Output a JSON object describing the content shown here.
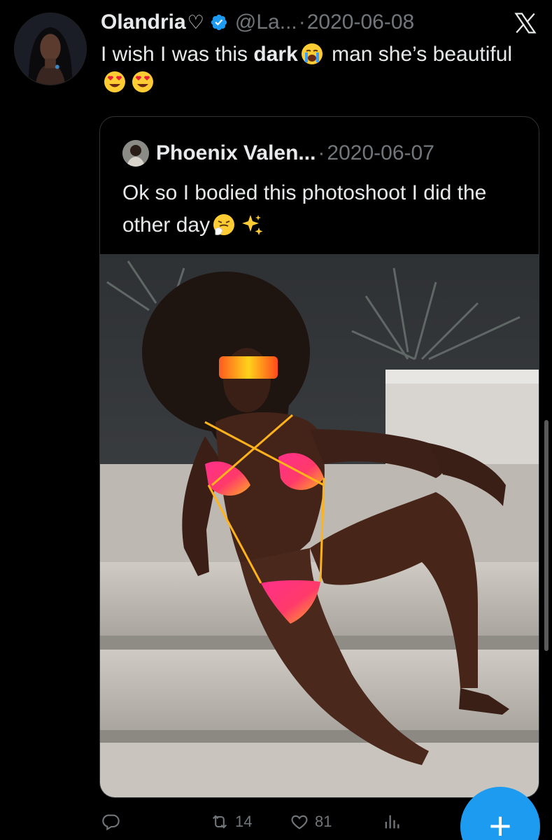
{
  "tweet": {
    "display_name": "Olandria",
    "name_suffix": "♡",
    "handle": "@La...",
    "separator": "·",
    "date": "2020-06-08",
    "text_before": "I wish I was this ",
    "text_bold": "dark",
    "text_after": " man she’s beautiful",
    "emojis": [
      "crying-face-emoji",
      "heart-eyes-emoji",
      "heart-eyes-emoji"
    ]
  },
  "quote": {
    "display_name": "Phoenix Valen...",
    "separator": "·",
    "date": "2020-06-07",
    "text": "Ok so I bodied this photoshoot I did the other day",
    "emojis": [
      "sneezing-face-emoji",
      "sparkles-emoji"
    ]
  },
  "actions": {
    "reply_count": "",
    "retweet_count": "14",
    "like_count": "81",
    "views_count": ""
  },
  "fab": {
    "label": "+"
  },
  "colors": {
    "accent": "#1d9bf0",
    "verified": "#1d9bf0",
    "muted": "#71767b",
    "text": "#e7e9ea",
    "border": "#2f3336"
  }
}
